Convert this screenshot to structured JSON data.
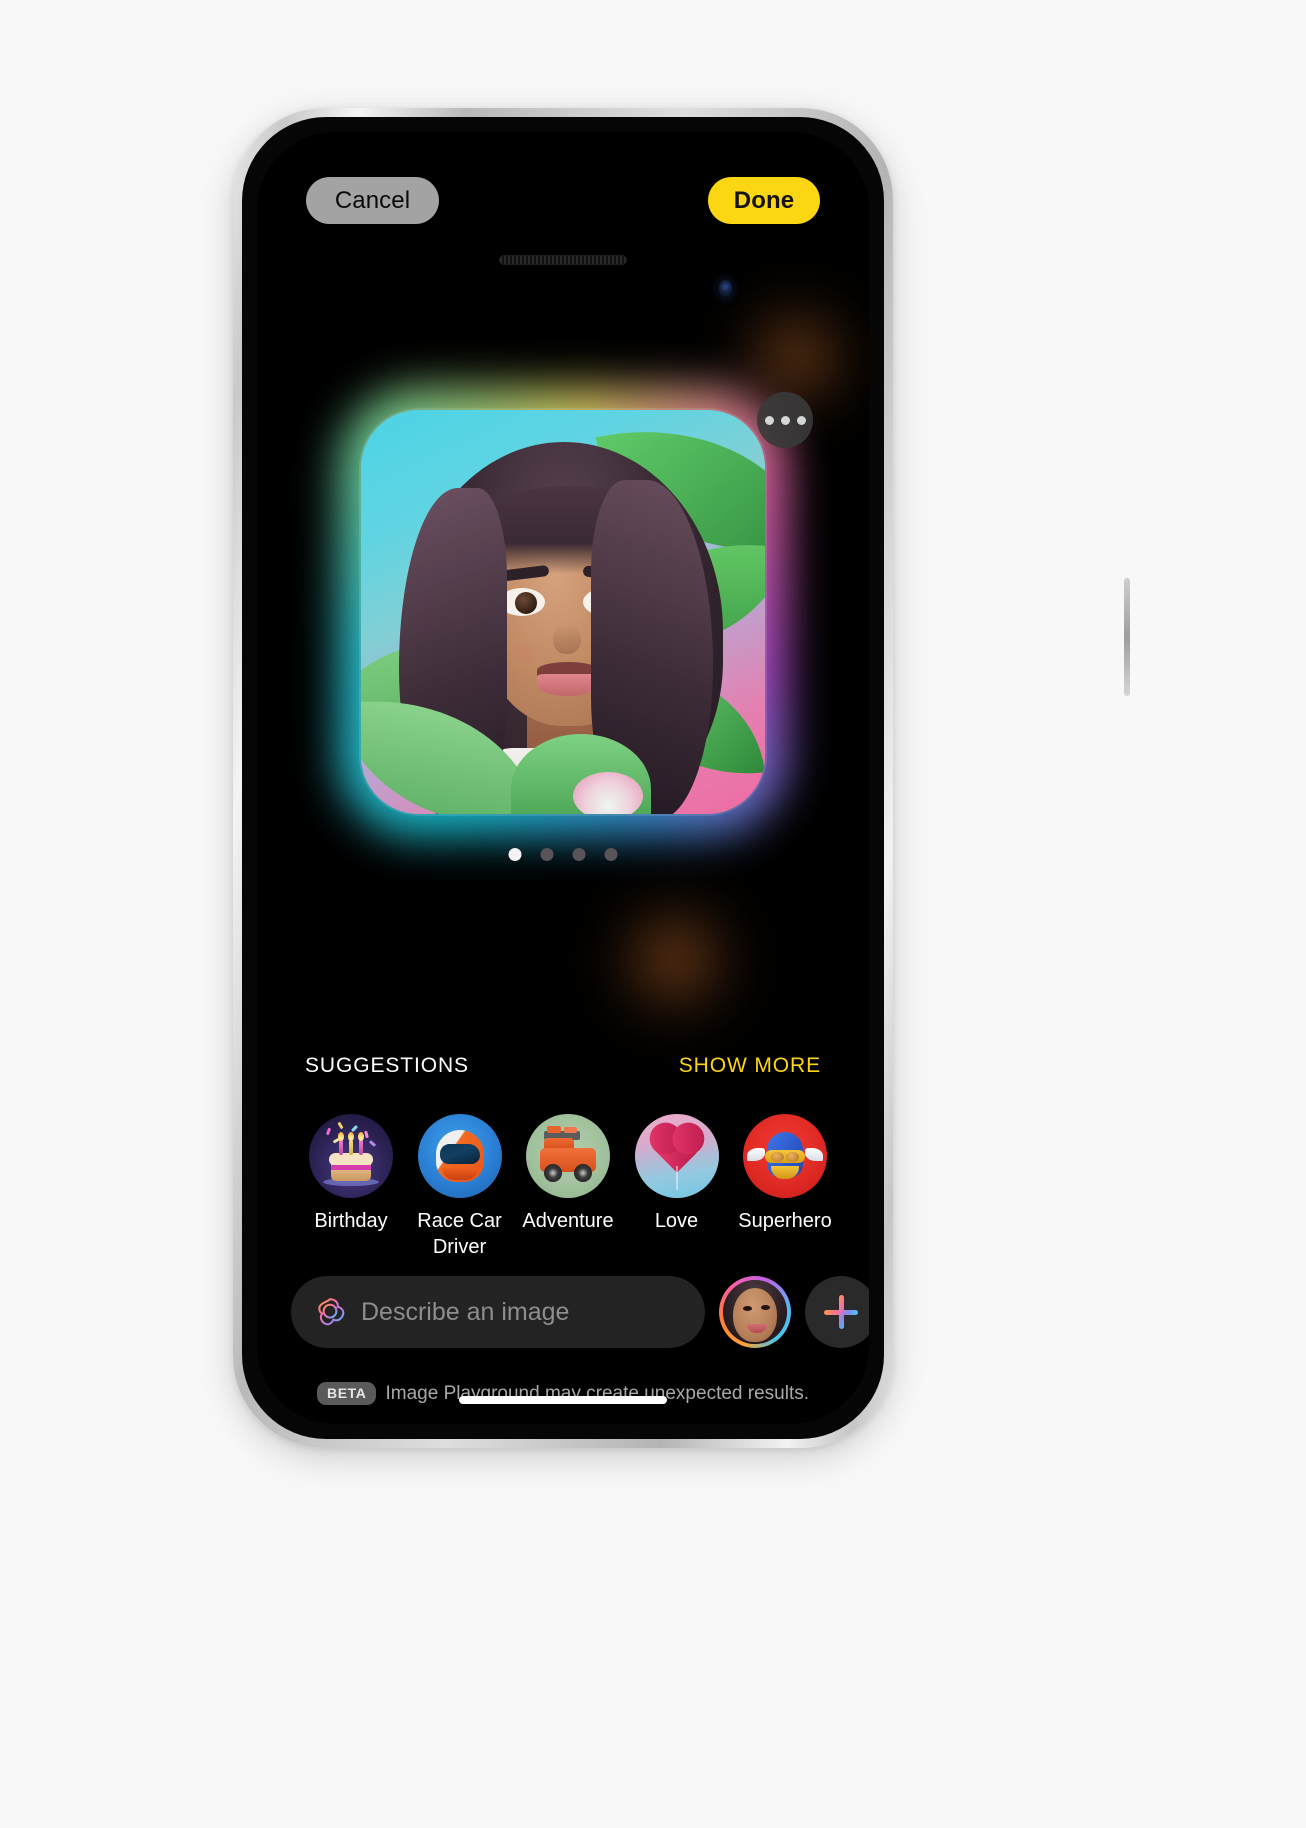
{
  "app": {
    "name": "Image Playground",
    "platform": "iPhone",
    "theme": "dark"
  },
  "top_bar": {
    "cancel_label": "Cancel",
    "done_label": "Done",
    "cancel_color": "#a3a3a3",
    "done_color": "#fcd612"
  },
  "canvas": {
    "more_button_icon": "ellipsis-icon",
    "image_alt": "Animation-style portrait of a smiling young woman with long curly dark hair surrounded by green leaves on a cyan and pink gradient background",
    "page_dots": {
      "total": 4,
      "active_index": 0
    }
  },
  "suggestions": {
    "title": "SUGGESTIONS",
    "show_more_label": "SHOW MORE",
    "show_more_color": "#fcd612",
    "items": [
      {
        "label": "Birthday",
        "icon": "birthday-cake-icon",
        "bg": "#2b2152"
      },
      {
        "label": "Race Car Driver",
        "icon": "racing-helmet-icon",
        "bg": "#2a7fd4"
      },
      {
        "label": "Adventure",
        "icon": "off-road-jeep-icon",
        "bg": "#9fc09a"
      },
      {
        "label": "Love",
        "icon": "heart-balloon-icon",
        "bg": "#d9a9cc"
      },
      {
        "label": "Superhero",
        "icon": "superhero-mask-icon",
        "bg": "#e02a24"
      }
    ]
  },
  "input_bar": {
    "sparkle_icon": "apple-intelligence-icon",
    "placeholder": "Describe an image",
    "value": "",
    "avatar_icon": "person-avatar",
    "add_icon": "plus-icon"
  },
  "footer": {
    "badge": "BETA",
    "text": "Image Playground may create unexpected results."
  }
}
